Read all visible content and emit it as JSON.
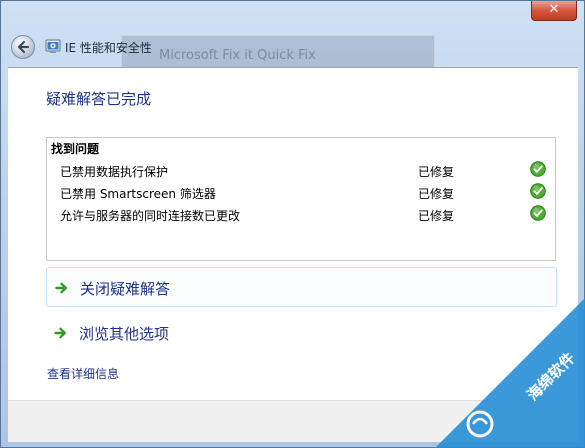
{
  "window": {
    "title": "IE 性能和安全性",
    "background_title": "Microsoft Fix it Quick Fix",
    "close_symbol": "✕"
  },
  "main": {
    "heading": "疑难解答已完成",
    "problems_group": {
      "title": "找到问题",
      "issues": [
        {
          "name": "已禁用数据执行保护",
          "status": "已修复"
        },
        {
          "name": "已禁用 Smartscreen 筛选器",
          "status": "已修复"
        },
        {
          "name": "允许与服务器的同时连接数已更改",
          "status": "已修复"
        }
      ]
    },
    "commands": [
      {
        "label": "关闭疑难解答",
        "selected": true
      },
      {
        "label": "浏览其他选项",
        "selected": false
      }
    ],
    "details_link": "查看详细信息"
  },
  "watermark": {
    "text": "海绵软件"
  },
  "colors": {
    "link_blue": "#1e3287",
    "check_green": "#4caf32",
    "arrow_green": "#2f9e2a",
    "close_red": "#c23c21"
  }
}
